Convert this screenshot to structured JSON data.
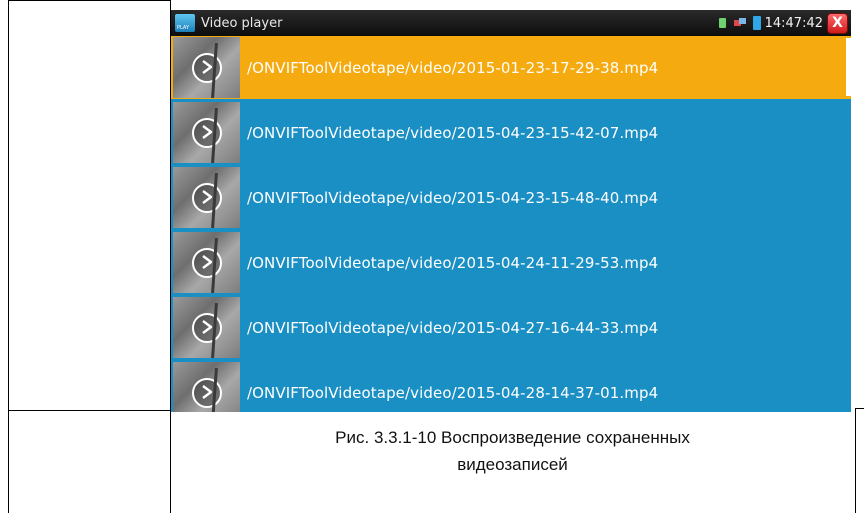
{
  "app": {
    "title": "Video player",
    "icon_text": "PLAY"
  },
  "status": {
    "time": "14:47:42",
    "close_label": "X"
  },
  "videos": [
    {
      "path": "/ONVIFToolVideotape/video/2015-01-23-17-29-38.mp4",
      "selected": true
    },
    {
      "path": "/ONVIFToolVideotape/video/2015-04-23-15-42-07.mp4",
      "selected": false
    },
    {
      "path": "/ONVIFToolVideotape/video/2015-04-23-15-48-40.mp4",
      "selected": false
    },
    {
      "path": "/ONVIFToolVideotape/video/2015-04-24-11-29-53.mp4",
      "selected": false
    },
    {
      "path": "/ONVIFToolVideotape/video/2015-04-27-16-44-33.mp4",
      "selected": false
    },
    {
      "path": "/ONVIFToolVideotape/video/2015-04-28-14-37-01.mp4",
      "selected": false
    }
  ],
  "caption": {
    "line1": "Рис. 3.3.1-10  Воспроизведение сохраненных",
    "line2": "видеозаписей"
  },
  "colors": {
    "selected_row": "#f5aa0f",
    "row": "#1a8fc4",
    "status_bar": "#111111"
  },
  "icons": {
    "play": "play-circle-icon",
    "close": "close-icon",
    "sd": "sd-card-icon",
    "network": "network-icon",
    "battery": "battery-icon"
  }
}
